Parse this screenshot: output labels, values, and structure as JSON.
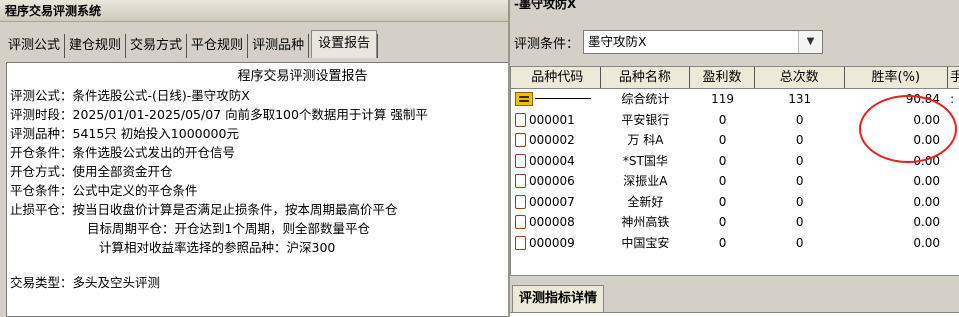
{
  "left_window": {
    "title": "程序交易评测系统",
    "tabs": [
      "评测公式",
      "建仓规则",
      "交易方式",
      "平仓规则",
      "评测品种",
      "设置报告"
    ],
    "active_tab": "设置报告",
    "report": {
      "title": "程序交易评测设置报告",
      "lines": [
        "评测公式：条件选股公式-(日线)-墨守攻防X",
        "评测时段：2025/01/01-2025/05/07 向前多取100个数据用于计算 强制平",
        "评测品种：5415只 初始投入1000000元",
        "开仓条件：条件选股公式发出的开仓信号",
        "开仓方式：使用全部资金开仓",
        "平仓条件：公式中定义的平仓条件",
        "止损平仓：按当日收盘价计算是否满足止损条件，按本周期最高价平仓"
      ],
      "indented_lines": [
        "目标周期平仓：开仓达到1个周期，则全部数量平仓",
        "计算相对收益率选择的参照品种：沪深300"
      ],
      "last_line": "交易类型：多头及空头评测"
    }
  },
  "right_window": {
    "title": "-墨守攻防X",
    "condition_label": "评测条件：",
    "condition_value": "墨守攻防X",
    "columns": [
      "品种代码",
      "品种名称",
      "盈利数",
      "总次数",
      "胜率(%)",
      "手"
    ],
    "summary_row": {
      "code": "",
      "name": "综合统计",
      "profit": "119",
      "total": "131",
      "rate": "90.84",
      "extra": ":"
    },
    "rows": [
      {
        "code": "000001",
        "name": "平安银行",
        "profit": "0",
        "total": "0",
        "rate": "0.00"
      },
      {
        "code": "000002",
        "name": "万 科A",
        "profit": "0",
        "total": "0",
        "rate": "0.00"
      },
      {
        "code": "000004",
        "name": "*ST国华",
        "profit": "0",
        "total": "0",
        "rate": "0.00"
      },
      {
        "code": "000006",
        "name": "深振业A",
        "profit": "0",
        "total": "0",
        "rate": "0.00"
      },
      {
        "code": "000007",
        "name": "全新好",
        "profit": "0",
        "total": "0",
        "rate": "0.00"
      },
      {
        "code": "000008",
        "name": "神州高铁",
        "profit": "0",
        "total": "0",
        "rate": "0.00"
      },
      {
        "code": "000009",
        "name": "中国宝安",
        "profit": "0",
        "total": "0",
        "rate": "0.00"
      }
    ],
    "bottom_tab": "评测指标详情",
    "highlight_color": "#e8221a"
  }
}
